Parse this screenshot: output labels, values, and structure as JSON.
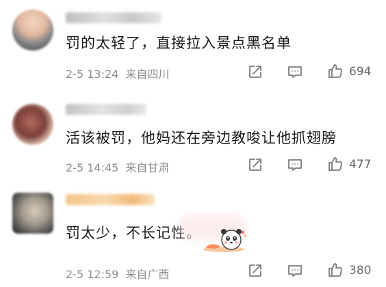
{
  "comments": [
    {
      "text": "罚的太轻了，直接拉入景点黑名单",
      "date": "2-5 13:24",
      "location": "来自四川",
      "likes": "694"
    },
    {
      "text": "活该被罚，他妈还在旁边教唆让他抓翅膀",
      "date": "2-5 14:45",
      "location": "来自甘肃",
      "likes": "477"
    },
    {
      "text": "罚太少，不长记性。",
      "date": "2-5 12:59",
      "location": "来自广西",
      "likes": "380"
    }
  ],
  "icons": {
    "share": "share-icon",
    "reply": "comment-icon",
    "like": "thumbs-up-icon",
    "sticker": "panda-sticker-icon"
  },
  "colors": {
    "text": "#1a1a1a",
    "meta": "#8c8c8c",
    "icon": "#7a7a7a"
  }
}
